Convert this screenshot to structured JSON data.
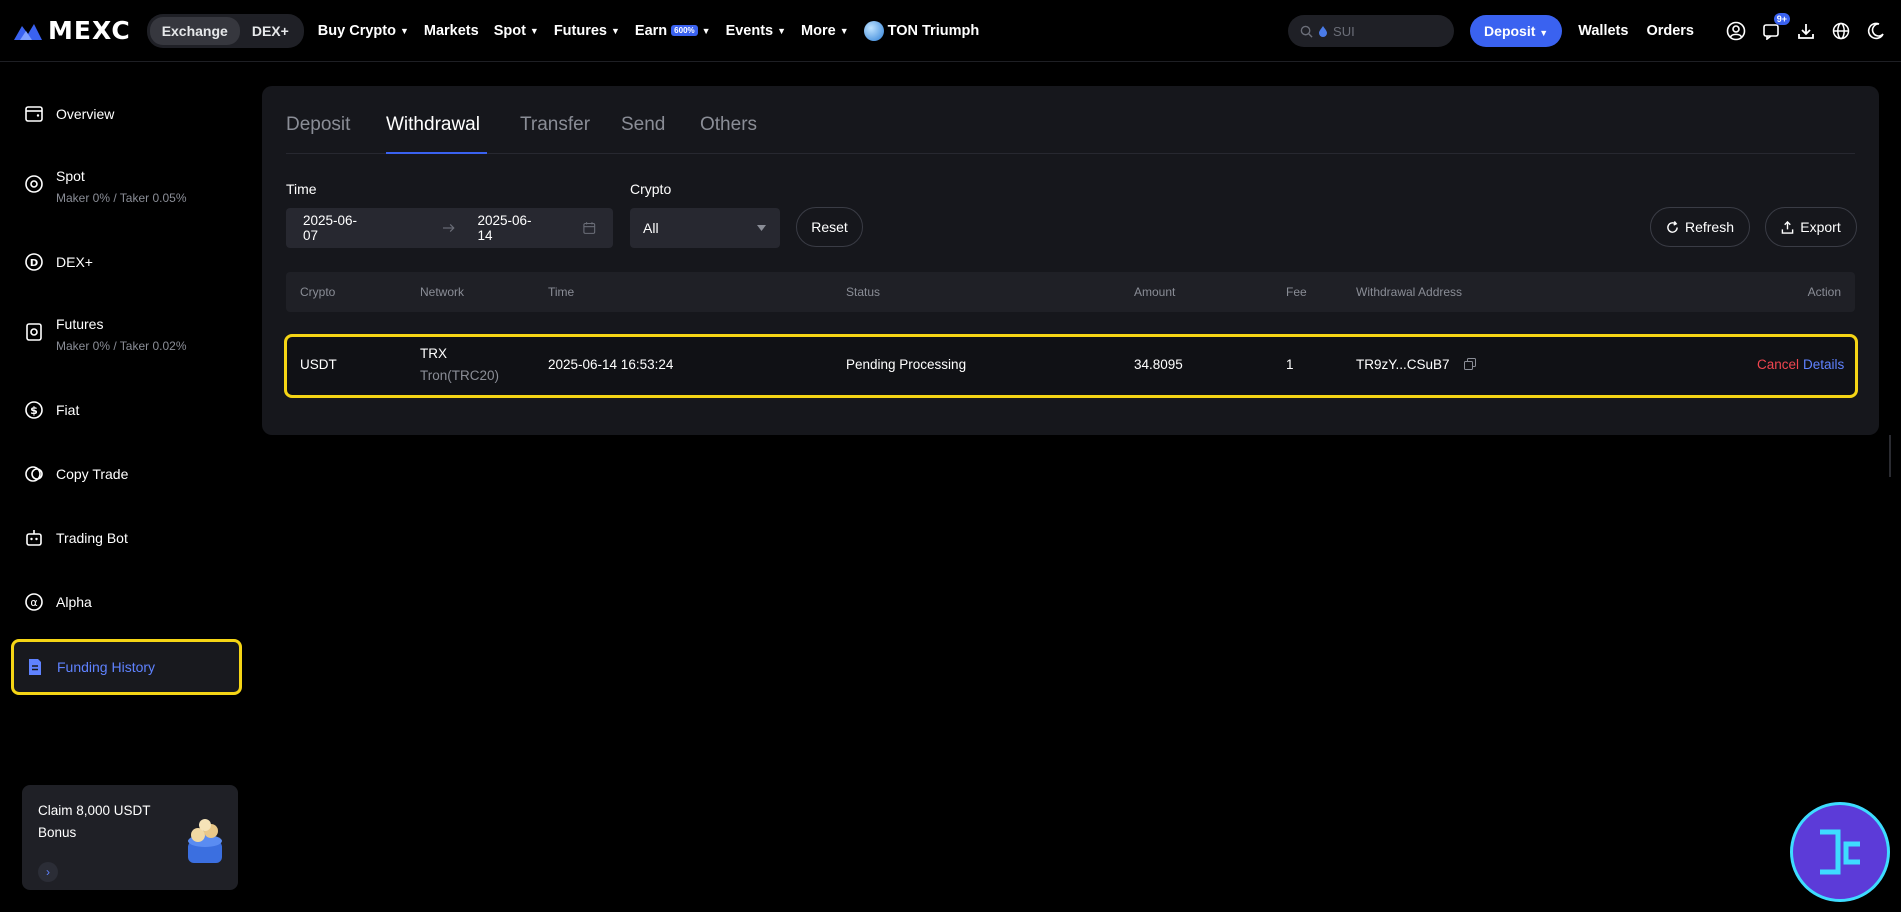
{
  "nav": {
    "logo": "MEXC",
    "segments": [
      "Exchange",
      "DEX+"
    ],
    "links": [
      {
        "label": "Buy Crypto",
        "caret": true
      },
      {
        "label": "Markets",
        "caret": false
      },
      {
        "label": "Spot",
        "caret": true
      },
      {
        "label": "Futures",
        "caret": true
      },
      {
        "label": "Earn",
        "caret": true,
        "badge": "600%"
      },
      {
        "label": "Events",
        "caret": true
      },
      {
        "label": "More",
        "caret": true
      }
    ],
    "ton_label": "TON Triumph",
    "search_placeholder": "SUI",
    "deposit_label": "Deposit",
    "wallets_label": "Wallets",
    "orders_label": "Orders",
    "notif_badge": "9+"
  },
  "sidebar": {
    "items": [
      {
        "label": "Overview",
        "sub": "",
        "icon": "wallet-icon"
      },
      {
        "label": "Spot",
        "sub": "Maker 0% / Taker 0.05%",
        "icon": "spot-icon"
      },
      {
        "label": "DEX+",
        "sub": "",
        "icon": "dex-icon"
      },
      {
        "label": "Futures",
        "sub": "Maker 0% / Taker 0.02%",
        "icon": "futures-icon"
      },
      {
        "label": "Fiat",
        "sub": "",
        "icon": "dollar-icon"
      },
      {
        "label": "Copy Trade",
        "sub": "",
        "icon": "copy-trade-icon"
      },
      {
        "label": "Trading Bot",
        "sub": "",
        "icon": "bot-icon"
      },
      {
        "label": "Alpha",
        "sub": "",
        "icon": "alpha-icon"
      }
    ],
    "active_label": "Funding History",
    "promo_text": "Claim 8,000 USDT Bonus"
  },
  "tabs": [
    "Deposit",
    "Withdrawal",
    "Transfer",
    "Send",
    "Others"
  ],
  "active_tab": "Withdrawal",
  "filters": {
    "time_label": "Time",
    "date_from": "2025-06-07",
    "date_to": "2025-06-14",
    "crypto_label": "Crypto",
    "crypto_value": "All",
    "reset_label": "Reset",
    "refresh_label": "Refresh",
    "export_label": "Export"
  },
  "table": {
    "headers": [
      "Crypto",
      "Network",
      "Time",
      "Status",
      "Amount",
      "Fee",
      "Withdrawal Address",
      "Action"
    ],
    "rows": [
      {
        "crypto": "USDT",
        "network": "TRX",
        "network_sub": "Tron(TRC20)",
        "time": "2025-06-14 16:53:24",
        "status": "Pending Processing",
        "amount": "34.8095",
        "fee": "1",
        "address": "TR9zY...CSuB7",
        "cancel_label": "Cancel",
        "details_label": "Details"
      }
    ]
  },
  "colors": {
    "accent": "#3a62f0",
    "highlight": "#f5d515",
    "cancel": "#f0454f",
    "link": "#5f82ff"
  }
}
